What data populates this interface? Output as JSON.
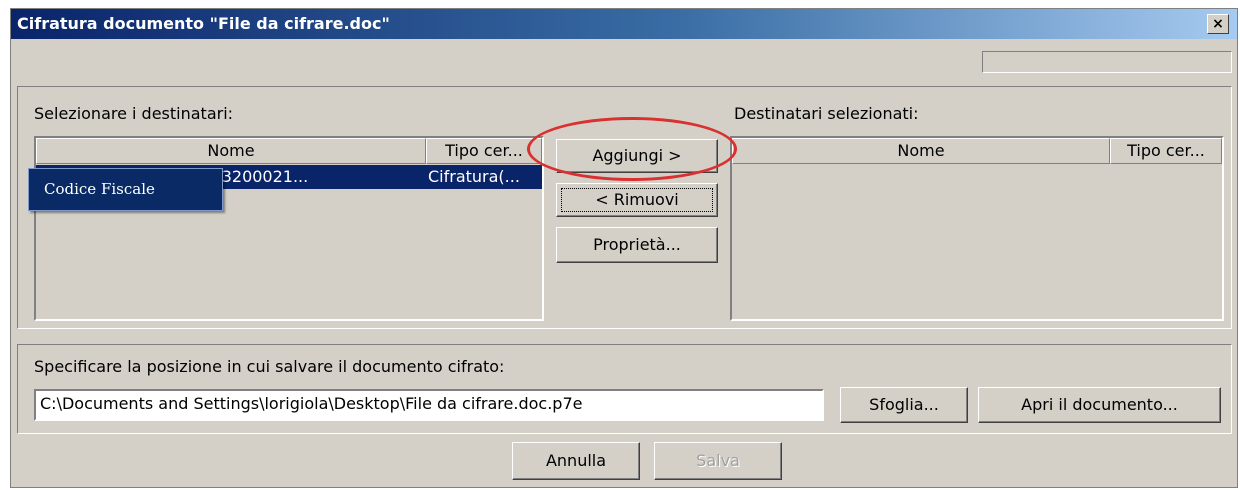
{
  "window": {
    "title": "Cifratura documento \"File da cifrare.doc\"",
    "close_label": "×"
  },
  "recipients": {
    "available_label": "Selezionare i destinatari:",
    "selected_label": "Destinatari selezionati:",
    "columns": [
      "Nome",
      "Tipo cer..."
    ],
    "available_rows": [
      {
        "name": "IT:RSSMRA75E/7420063200021...",
        "type": "Cifratura(..."
      }
    ],
    "selected_rows": []
  },
  "buttons": {
    "add": "Aggiungi >",
    "remove": "< Rimuovi",
    "properties": "Proprietà...",
    "browse": "Sfoglia...",
    "open_document": "Apri il documento...",
    "cancel": "Annulla",
    "save": "Salva"
  },
  "save_location": {
    "label": "Specificare la posizione in cui salvare il documento cifrato:",
    "path": "C:\\Documents and Settings\\lorigiola\\Desktop\\File da cifrare.doc.p7e"
  },
  "tooltip": {
    "text": "Codice Fiscale"
  },
  "colors": {
    "title_start": "#0a246a",
    "title_end": "#a6caf0",
    "selection": "#0a246a",
    "highlight_ring": "#d93030",
    "dialog_face": "#d4d0c8"
  }
}
